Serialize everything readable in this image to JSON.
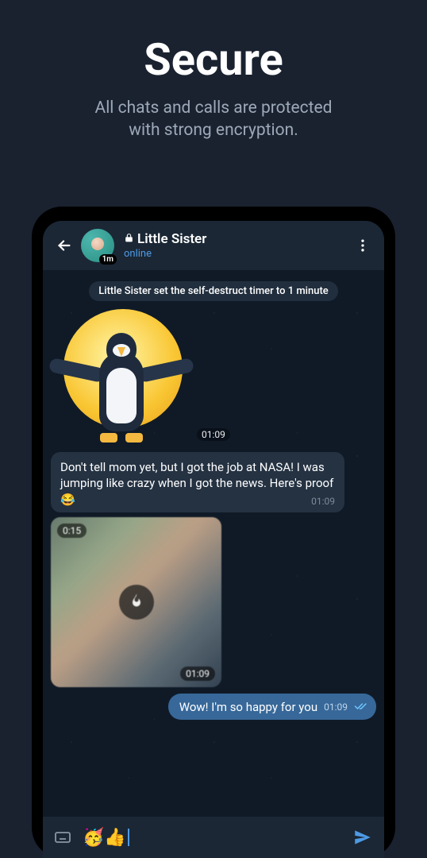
{
  "hero": {
    "title": "Secure",
    "subtitle_line1": "All chats and calls are protected",
    "subtitle_line2": "with strong encryption."
  },
  "header": {
    "contact_name": "Little Sister",
    "status": "online",
    "timer_badge": "1m"
  },
  "system_message": "Little Sister set the self-destruct timer to 1 minute",
  "messages": {
    "sticker_time": "01:09",
    "text1": "Don't tell mom yet, but I got the job at NASA! I was jumping like crazy when I got the news. Here's proof ",
    "text1_emoji": "😂",
    "text1_time": "01:09",
    "media_duration": "0:15",
    "media_time": "01:09",
    "out1_text": "Wow! I'm so happy for you",
    "out1_time": "01:09"
  },
  "compose": {
    "emoji_content": "🥳👍"
  }
}
